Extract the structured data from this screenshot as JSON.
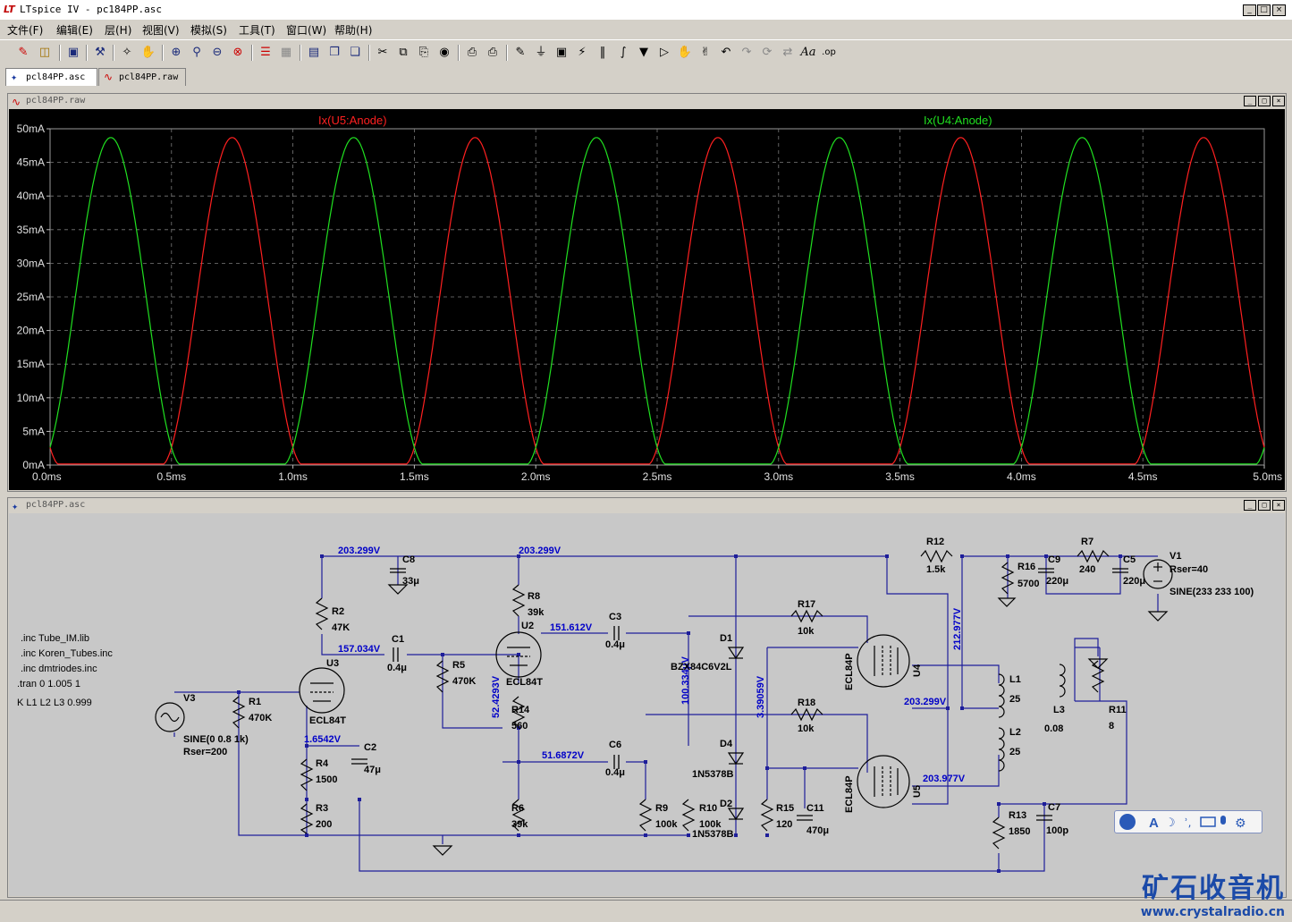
{
  "window": {
    "title": "LTspice IV - pc184PP.asc",
    "controls": [
      "_",
      "□",
      "×"
    ]
  },
  "menu": [
    "文件(F)",
    "编辑(E)",
    "层(H)",
    "视图(V)",
    "模拟(S)",
    "工具(T)",
    "窗口(W)",
    "帮助(H)"
  ],
  "tabs": [
    {
      "label": "pcl84PP.asc",
      "icon": "schematic-icon"
    },
    {
      "label": "pcl84PP.raw",
      "icon": "waveform-icon"
    }
  ],
  "waveform_window": {
    "title": "pcl84PP.raw",
    "trace_red_label": "Ix(U5:Anode)",
    "trace_green_label": "Ix(U4:Anode)"
  },
  "schematic_window": {
    "title": "pcl84PP.asc"
  },
  "chart_data": {
    "type": "line",
    "x_unit": "ms",
    "y_unit": "mA",
    "xlim": [
      0,
      5
    ],
    "ylim": [
      0,
      50
    ],
    "x_ticks": [
      "0.0ms",
      "0.5ms",
      "1.0ms",
      "1.5ms",
      "2.0ms",
      "2.5ms",
      "3.0ms",
      "3.5ms",
      "4.0ms",
      "4.5ms",
      "5.0ms"
    ],
    "y_ticks": [
      "0mA",
      "5mA",
      "10mA",
      "15mA",
      "20mA",
      "25mA",
      "30mA",
      "35mA",
      "40mA",
      "45mA",
      "50mA"
    ],
    "grid": true,
    "series": [
      {
        "name": "Ix(U5:Anode)",
        "color": "#ff2020",
        "peak": 48.7,
        "period_ms": 1.0,
        "peaks_at_ms": [
          0.75,
          1.75,
          2.75,
          3.75,
          4.75
        ],
        "start_value": 7
      },
      {
        "name": "Ix(U4:Anode)",
        "color": "#20e020",
        "peak": 48.7,
        "period_ms": 1.0,
        "peaks_at_ms": [
          0.25,
          1.25,
          2.25,
          3.25,
          4.25
        ],
        "start_value": 7
      }
    ]
  },
  "schematic": {
    "directives": [
      ".inc Tube_IM.lib",
      ".inc Koren_Tubes.inc",
      ".inc dmtriodes.inc",
      ".tran 0 1.005 1",
      "K L1 L2 L3 0.999"
    ],
    "node_voltages": [
      "203.299V",
      "203.299V",
      "157.034V",
      "151.612V",
      "1.6542V",
      "52.4293V",
      "51.6872V",
      "100.334μV",
      "3.39059V",
      "212.977V",
      "203.299V",
      "203.977V"
    ],
    "components": [
      {
        "ref": "C8",
        "value": "33μ"
      },
      {
        "ref": "R2",
        "value": "47K"
      },
      {
        "ref": "C1",
        "value": "0.4μ"
      },
      {
        "ref": "U3",
        "value": "ECL84T"
      },
      {
        "ref": "V3",
        "value": "SINE(0 0.8 1k)"
      },
      {
        "ref": "V3_rser",
        "value": "Rser=200"
      },
      {
        "ref": "R1",
        "value": "470K"
      },
      {
        "ref": "R4",
        "value": "1500"
      },
      {
        "ref": "R3",
        "value": "200"
      },
      {
        "ref": "C2",
        "value": "47μ"
      },
      {
        "ref": "R8",
        "value": "39k"
      },
      {
        "ref": "U2",
        "value": "ECL84T"
      },
      {
        "ref": "R5",
        "value": "470K"
      },
      {
        "ref": "R14",
        "value": "560"
      },
      {
        "ref": "R6",
        "value": "39k"
      },
      {
        "ref": "C3",
        "value": "0.4μ"
      },
      {
        "ref": "C6",
        "value": "0.4μ"
      },
      {
        "ref": "R9",
        "value": "100k"
      },
      {
        "ref": "R10",
        "value": "100k"
      },
      {
        "ref": "D1",
        "value": "BZX84C6V2L"
      },
      {
        "ref": "D4",
        "value": "1N5378B"
      },
      {
        "ref": "D2",
        "value": "1N5378B"
      },
      {
        "ref": "R17",
        "value": "10k"
      },
      {
        "ref": "R18",
        "value": "10k"
      },
      {
        "ref": "R15",
        "value": "120"
      },
      {
        "ref": "C11",
        "value": "470μ"
      },
      {
        "ref": "U4",
        "value": "ECL84P"
      },
      {
        "ref": "U5",
        "value": "ECL84P"
      },
      {
        "ref": "R12",
        "value": "1.5k"
      },
      {
        "ref": "R16",
        "value": "5700"
      },
      {
        "ref": "C9",
        "value": "220μ"
      },
      {
        "ref": "R7",
        "value": "240"
      },
      {
        "ref": "C5",
        "value": "220μ"
      },
      {
        "ref": "V1",
        "value": "Rser=40"
      },
      {
        "ref": "V1_src",
        "value": "SINE(233 233 100)"
      },
      {
        "ref": "L1",
        "value": "25"
      },
      {
        "ref": "L2",
        "value": "25"
      },
      {
        "ref": "L3",
        "value": "0.08"
      },
      {
        "ref": "R11",
        "value": "8"
      },
      {
        "ref": "R13",
        "value": "1850"
      },
      {
        "ref": "C7",
        "value": "100p"
      }
    ]
  },
  "watermark": {
    "cn": "矿石收音机",
    "url": "www.crystalradio.cn"
  }
}
